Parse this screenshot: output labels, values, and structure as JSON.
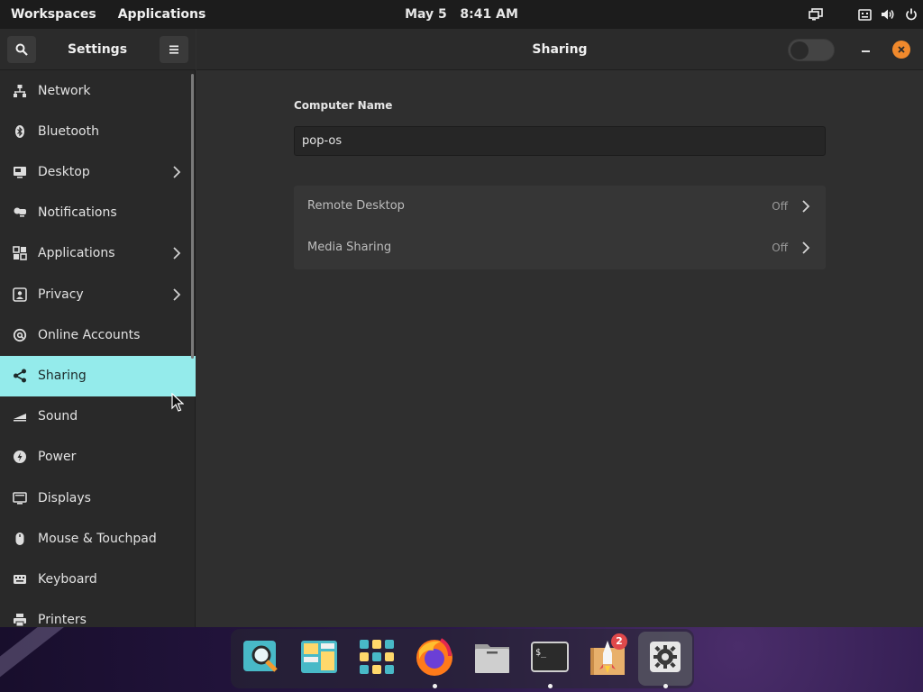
{
  "topbar": {
    "workspaces": "Workspaces",
    "applications": "Applications",
    "date": "May 5",
    "time": "8:41 AM",
    "tray_icons": [
      "display-icon",
      "keyboard-icon",
      "volume-icon",
      "power-icon"
    ]
  },
  "sidebar": {
    "title": "Settings",
    "items": [
      {
        "label": "Network",
        "icon": "network-icon",
        "chevron": false
      },
      {
        "label": "Bluetooth",
        "icon": "bluetooth-icon",
        "chevron": false
      },
      {
        "label": "Desktop",
        "icon": "desktop-icon",
        "chevron": true
      },
      {
        "label": "Notifications",
        "icon": "notifications-icon",
        "chevron": false
      },
      {
        "label": "Applications",
        "icon": "applications-icon",
        "chevron": true
      },
      {
        "label": "Privacy",
        "icon": "privacy-icon",
        "chevron": true
      },
      {
        "label": "Online Accounts",
        "icon": "online-accounts-icon",
        "chevron": false
      },
      {
        "label": "Sharing",
        "icon": "sharing-icon",
        "chevron": false,
        "active": true
      },
      {
        "label": "Sound",
        "icon": "sound-icon",
        "chevron": false
      },
      {
        "label": "Power",
        "icon": "power-icon",
        "chevron": false
      },
      {
        "label": "Displays",
        "icon": "displays-icon",
        "chevron": false
      },
      {
        "label": "Mouse & Touchpad",
        "icon": "mouse-icon",
        "chevron": false
      },
      {
        "label": "Keyboard",
        "icon": "keyboard-icon",
        "chevron": false
      },
      {
        "label": "Printers",
        "icon": "printer-icon",
        "chevron": false
      }
    ]
  },
  "content": {
    "title": "Sharing",
    "sharing_enabled": false,
    "computer_name_label": "Computer Name",
    "computer_name_value": "pop-os",
    "rows": [
      {
        "label": "Remote Desktop",
        "status": "Off"
      },
      {
        "label": "Media Sharing",
        "status": "Off"
      }
    ]
  },
  "dock": {
    "apps": [
      {
        "name": "search-app-icon",
        "running": false
      },
      {
        "name": "workspaces-app-icon",
        "running": false
      },
      {
        "name": "app-library-icon",
        "running": false
      },
      {
        "name": "firefox-icon",
        "running": true
      },
      {
        "name": "files-icon",
        "running": false
      },
      {
        "name": "terminal-icon",
        "running": true
      },
      {
        "name": "pop-shop-icon",
        "running": false,
        "badge": "2"
      },
      {
        "name": "settings-app-icon",
        "running": true,
        "active": true
      }
    ]
  },
  "colors": {
    "accent": "#94ebeb",
    "close_button": "#f0892c",
    "badge": "#e0494b"
  }
}
